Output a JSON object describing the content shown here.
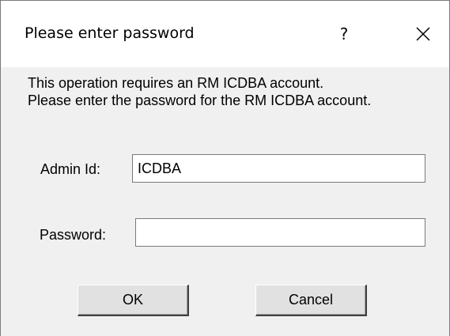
{
  "window": {
    "title": "Please enter password",
    "help_glyph": "?",
    "close_icon": "close-icon"
  },
  "message": {
    "line1": "This operation requires an RM ICDBA account.",
    "line2": "Please enter the password for the RM ICDBA account."
  },
  "form": {
    "admin_id_label": "Admin Id:",
    "admin_id_value": "ICDBA",
    "password_label": "Password:",
    "password_value": ""
  },
  "buttons": {
    "ok_label": "OK",
    "cancel_label": "Cancel"
  }
}
